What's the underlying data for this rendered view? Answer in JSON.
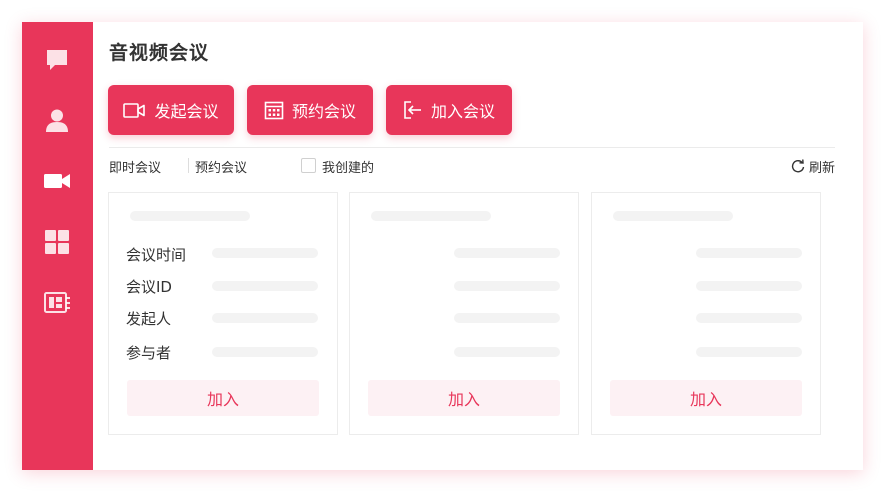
{
  "colors": {
    "accent": "#e8365a",
    "join_bg": "#fdf1f4",
    "skeleton": "#f3f3f3"
  },
  "sidebar": {
    "items": [
      {
        "icon": "chat-bubble-icon"
      },
      {
        "icon": "user-icon"
      },
      {
        "icon": "video-camera-icon"
      },
      {
        "icon": "grid-apps-icon"
      },
      {
        "icon": "meeting-board-icon"
      }
    ]
  },
  "main": {
    "title": "音视频会议",
    "actions": [
      {
        "label": "发起会议",
        "icon": "video-camera-outline-icon"
      },
      {
        "label": "预约会议",
        "icon": "calendar-icon"
      },
      {
        "label": "加入会议",
        "icon": "enter-icon"
      }
    ],
    "filters": {
      "tabs": [
        "即时会议",
        "预约会议"
      ],
      "mine_label": "我创建的",
      "mine_checked": false,
      "refresh_label": "刷新"
    },
    "cards": [
      {
        "fields": [
          "会议时间",
          "会议ID",
          "发起人",
          "参与者"
        ],
        "join_label": "加入"
      },
      {
        "fields": [],
        "join_label": "加入"
      },
      {
        "fields": [],
        "join_label": "加入"
      }
    ]
  }
}
